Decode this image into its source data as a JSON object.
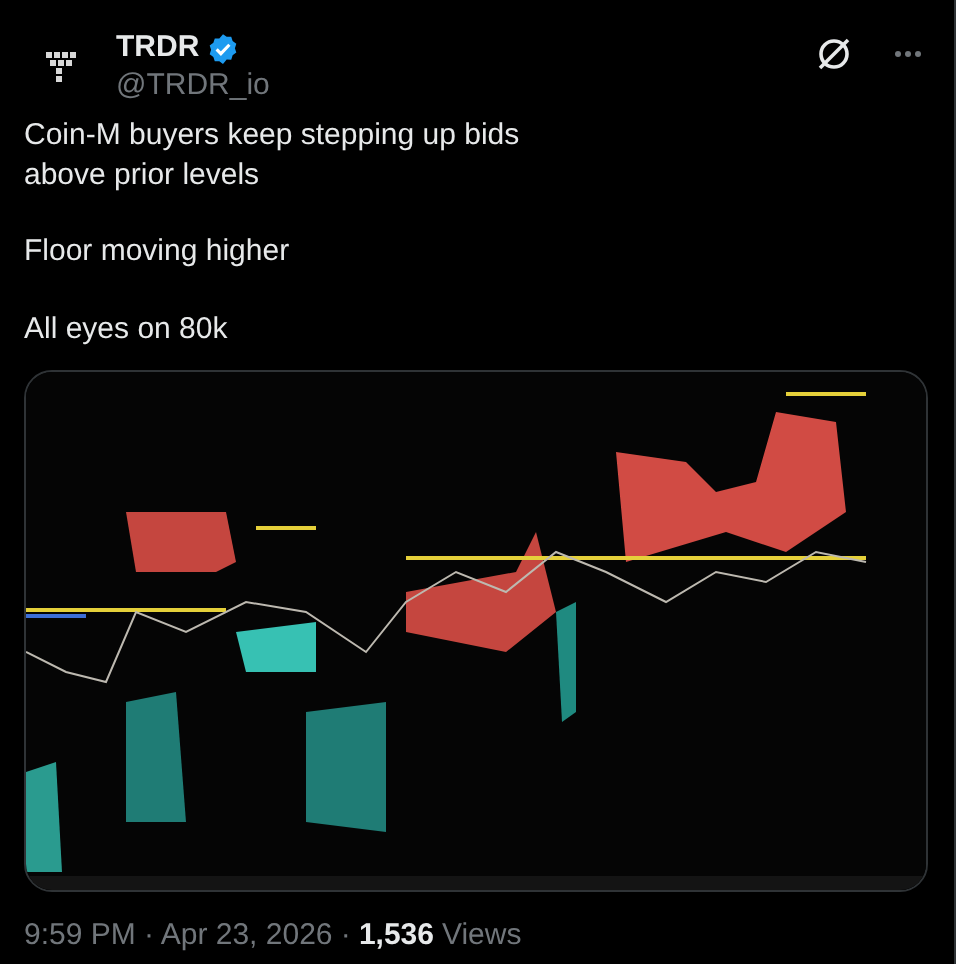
{
  "author": {
    "name": "TRDR",
    "verified": true,
    "handle": "@TRDR_io"
  },
  "post": {
    "paragraphs": [
      "Coin-M buyers keep stepping up bids\nabove prior levels",
      "Floor moving higher",
      "All eyes on 80k"
    ]
  },
  "footer": {
    "timestamp": "9:59 PM · Apr 23, 2026 ·",
    "views": "1,536",
    "views_label": "Views"
  }
}
